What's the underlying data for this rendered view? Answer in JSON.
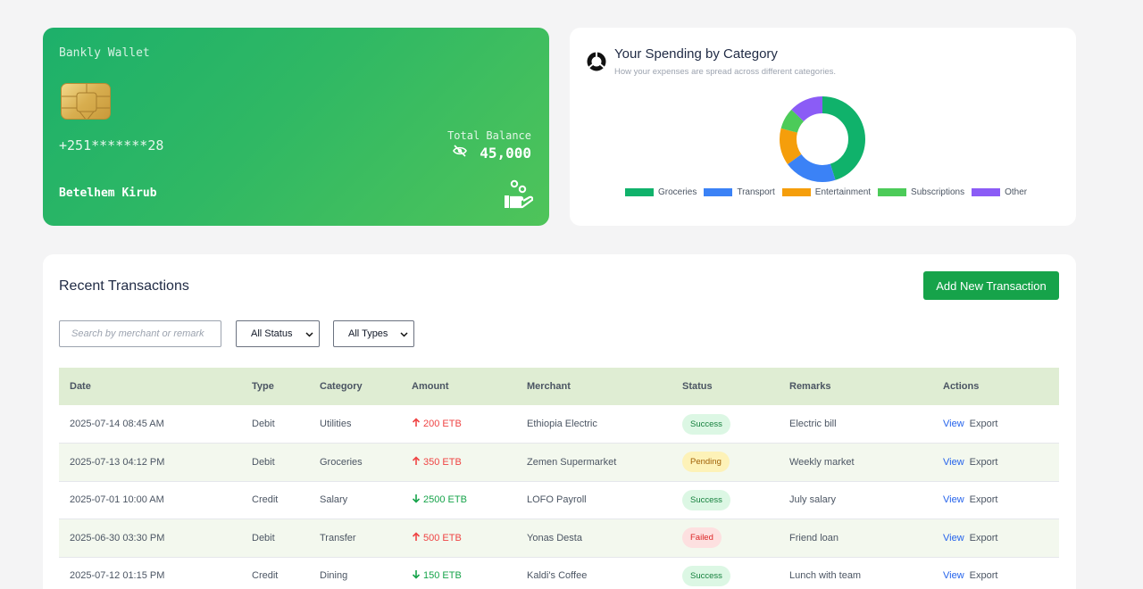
{
  "wallet": {
    "brand": "Bankly Wallet",
    "phone": "+251*******28",
    "holder": "Betelhem Kirub",
    "balance_label": "Total Balance",
    "balance": "45,000",
    "colors": {
      "start": "#1db06a",
      "end": "#4fc45a"
    },
    "icons": {
      "visibility": "eye-off-icon",
      "action": "hand-coins-icon",
      "chip": "card-chip-icon"
    }
  },
  "spending": {
    "title": "Your Spending by Category",
    "subtitle": "How your expenses are spread across different categories.",
    "logo_icon": "donut-chart-icon",
    "chart_data": {
      "type": "pie",
      "categories": [
        "Groceries",
        "Transport",
        "Entertainment",
        "Subscriptions",
        "Other"
      ],
      "values": [
        45,
        20,
        14,
        8,
        13
      ],
      "colors": [
        "#10b26b",
        "#3b82f6",
        "#f59e0b",
        "#4ccb59",
        "#8b5cf6"
      ],
      "legend_position": "bottom"
    }
  },
  "transactions": {
    "title": "Recent Transactions",
    "add_button": "Add New Transaction",
    "search_placeholder": "Search by merchant or remark",
    "status_filter": "All Status",
    "type_filter": "All Types",
    "columns": [
      "Date",
      "Type",
      "Category",
      "Amount",
      "Merchant",
      "Status",
      "Remarks",
      "Actions"
    ],
    "rows": [
      {
        "date": "2025-07-14 08:45 AM",
        "type": "Debit",
        "category": "Utilities",
        "amount": "200 ETB",
        "direction": "debit",
        "merchant": "Ethiopia Electric",
        "status": "Success",
        "remarks": "Electric bill",
        "view": "View",
        "export": "Export"
      },
      {
        "date": "2025-07-13 04:12 PM",
        "type": "Debit",
        "category": "Groceries",
        "amount": "350 ETB",
        "direction": "debit",
        "merchant": "Zemen Supermarket",
        "status": "Pending",
        "remarks": "Weekly market",
        "view": "View",
        "export": "Export"
      },
      {
        "date": "2025-07-01 10:00 AM",
        "type": "Credit",
        "category": "Salary",
        "amount": "2500 ETB",
        "direction": "credit",
        "merchant": "LOFO Payroll",
        "status": "Success",
        "remarks": "July salary",
        "view": "View",
        "export": "Export"
      },
      {
        "date": "2025-06-30 03:30 PM",
        "type": "Debit",
        "category": "Transfer",
        "amount": "500 ETB",
        "direction": "debit",
        "merchant": "Yonas Desta",
        "status": "Failed",
        "remarks": "Friend loan",
        "view": "View",
        "export": "Export"
      },
      {
        "date": "2025-07-12 01:15 PM",
        "type": "Credit",
        "category": "Dining",
        "amount": "150 ETB",
        "direction": "credit",
        "merchant": "Kaldi's Coffee",
        "status": "Success",
        "remarks": "Lunch with team",
        "view": "View",
        "export": "Export"
      }
    ]
  }
}
